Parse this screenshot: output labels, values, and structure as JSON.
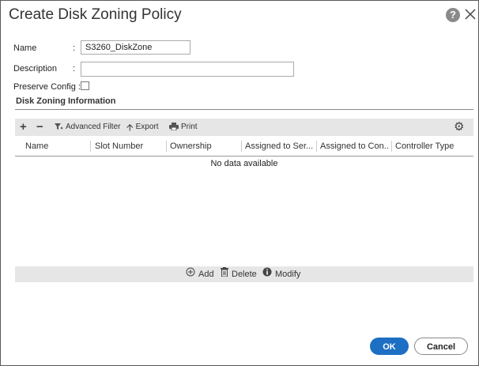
{
  "dialog": {
    "title": "Create Disk Zoning Policy",
    "help_label": "?"
  },
  "form": {
    "name_label": "Name",
    "name_value": "S3260_DiskZone",
    "description_label": "Description",
    "description_value": "",
    "preserve_label": "Preserve Config :",
    "colon": ":"
  },
  "section": {
    "title": "Disk Zoning Information"
  },
  "toolbar": {
    "add_icon": "plus-icon",
    "remove_icon": "minus-icon",
    "advanced_filter": "Advanced Filter",
    "export": "Export",
    "print": "Print",
    "settings_icon": "gear-icon"
  },
  "table": {
    "columns": [
      "Name",
      "Slot Number",
      "Ownership",
      "Assigned to Ser...",
      "Assigned to Con...",
      "Controller Type"
    ],
    "empty_text": "No data available"
  },
  "actions": {
    "add": "Add",
    "delete": "Delete",
    "modify": "Modify"
  },
  "footer": {
    "ok": "OK",
    "cancel": "Cancel"
  },
  "colors": {
    "primary": "#1d6fc4",
    "toolbar_bg": "#e6e6e6"
  }
}
